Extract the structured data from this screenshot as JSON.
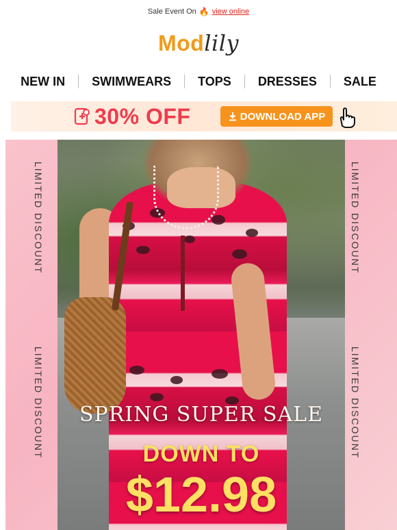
{
  "topbar": {
    "text": "Sale Event On",
    "icon": "fire-icon",
    "link_label": "view online",
    "link_color": "#e0201a"
  },
  "logo": {
    "part1": "Mod",
    "part2": "lily",
    "part1_color": "#f29a1a",
    "part2_color": "#2a2a2a"
  },
  "nav": {
    "items": [
      "NEW IN",
      "SWIMWEARS",
      "TOPS",
      "DRESSES",
      "SALE"
    ]
  },
  "promo": {
    "discount_text": "30% OFF",
    "button_label": "DOWNLOAD APP",
    "button_icon": "download-icon",
    "hand_icon": "pointer-hand-icon",
    "accent": "#f03b4d",
    "button_color": "#f7931d"
  },
  "hero": {
    "side_left_top": "LIMITED DISCOUNT",
    "side_left_bottom": "LIMITED DISCOUNT",
    "side_right_top": "LIMITED DISCOUNT",
    "side_right_bottom": "LIMITED DISCOUNT",
    "headline": "SPRING SUPER SALE",
    "subheadline": "DOWN TO",
    "price": "$12.98",
    "price_color": "#ffe063"
  }
}
